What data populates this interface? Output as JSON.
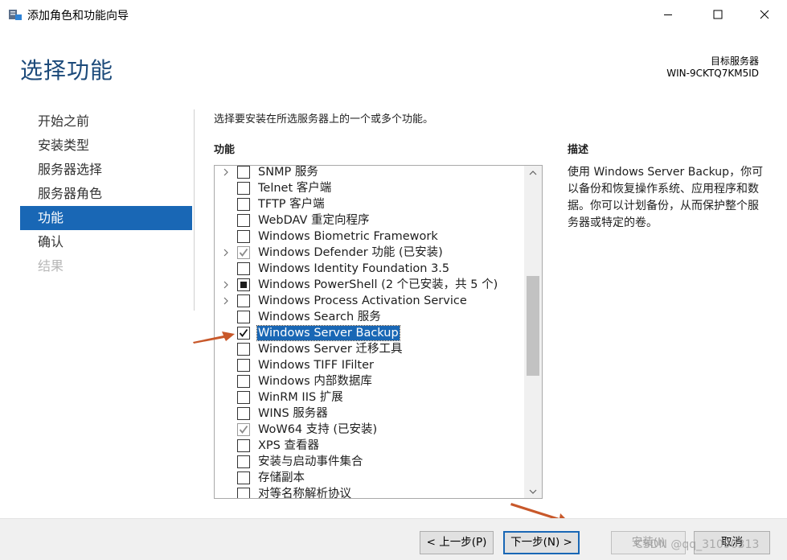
{
  "window": {
    "title": "添加角色和功能向导",
    "controls": {
      "minimize": "minimize-icon",
      "maximize": "maximize-icon",
      "close": "close-icon"
    }
  },
  "header": {
    "title": "选择功能",
    "target_label": "目标服务器",
    "target_value": "WIN-9CKTQ7KM5ID"
  },
  "nav": {
    "items": [
      {
        "label": "开始之前",
        "state": "normal"
      },
      {
        "label": "安装类型",
        "state": "normal"
      },
      {
        "label": "服务器选择",
        "state": "normal"
      },
      {
        "label": "服务器角色",
        "state": "normal"
      },
      {
        "label": "功能",
        "state": "active"
      },
      {
        "label": "确认",
        "state": "normal"
      },
      {
        "label": "结果",
        "state": "disabled"
      }
    ]
  },
  "main": {
    "instruction": "选择要安装在所选服务器上的一个或多个功能。",
    "features_heading": "功能",
    "features": [
      {
        "label": "SNMP 服务",
        "expandable": true,
        "check": "none"
      },
      {
        "label": "Telnet 客户端",
        "expandable": false,
        "check": "none"
      },
      {
        "label": "TFTP 客户端",
        "expandable": false,
        "check": "none"
      },
      {
        "label": "WebDAV 重定向程序",
        "expandable": false,
        "check": "none"
      },
      {
        "label": "Windows Biometric Framework",
        "expandable": false,
        "check": "none"
      },
      {
        "label": "Windows Defender 功能 (已安装)",
        "expandable": true,
        "check": "installed"
      },
      {
        "label": "Windows Identity Foundation 3.5",
        "expandable": false,
        "check": "none"
      },
      {
        "label": "Windows PowerShell (2 个已安装，共 5 个)",
        "expandable": true,
        "check": "partial"
      },
      {
        "label": "Windows Process Activation Service",
        "expandable": true,
        "check": "none"
      },
      {
        "label": "Windows Search 服务",
        "expandable": false,
        "check": "none"
      },
      {
        "label": "Windows Server Backup",
        "expandable": false,
        "check": "checked",
        "selected": true
      },
      {
        "label": "Windows Server 迁移工具",
        "expandable": false,
        "check": "none"
      },
      {
        "label": "Windows TIFF IFilter",
        "expandable": false,
        "check": "none"
      },
      {
        "label": "Windows 内部数据库",
        "expandable": false,
        "check": "none"
      },
      {
        "label": "WinRM IIS 扩展",
        "expandable": false,
        "check": "none"
      },
      {
        "label": "WINS 服务器",
        "expandable": false,
        "check": "none"
      },
      {
        "label": "WoW64 支持 (已安装)",
        "expandable": false,
        "check": "installed"
      },
      {
        "label": "XPS 查看器",
        "expandable": false,
        "check": "none"
      },
      {
        "label": "安装与启动事件集合",
        "expandable": false,
        "check": "none"
      },
      {
        "label": "存储副本",
        "expandable": false,
        "check": "none"
      },
      {
        "label": "对等名称解析协议",
        "expandable": false,
        "check": "none"
      }
    ],
    "description_heading": "描述",
    "description_text": "使用 Windows Server Backup，你可以备份和恢复操作系统、应用程序和数据。你可以计划备份，从而保护整个服务器或特定的卷。"
  },
  "footer": {
    "prev_label": "< 上一步(P)",
    "next_label": "下一步(N) >",
    "install_label": "安装(I)",
    "cancel_label": "取消"
  },
  "watermark": "CSDN @qq_31090313",
  "colors": {
    "accent": "#1967b5",
    "title": "#1c4a7a",
    "annotation_arrow": "#c8582a"
  }
}
